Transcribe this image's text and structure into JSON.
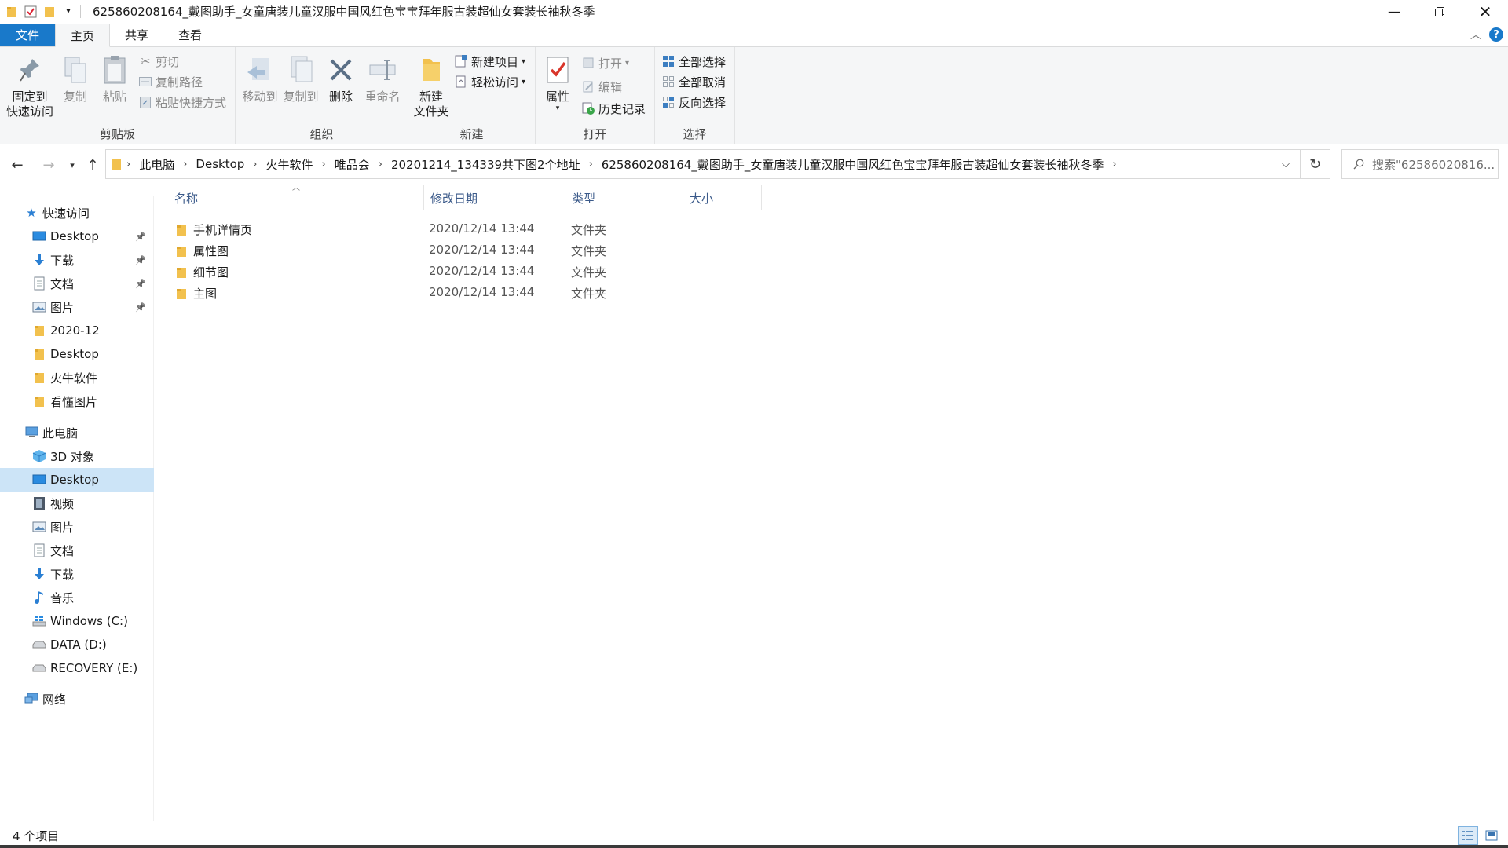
{
  "window": {
    "title": "625860208164_戴图助手_女童唐装儿童汉服中国风红色宝宝拜年服古装超仙女套装长袖秋冬季"
  },
  "ribbon_tabs": [
    "文件",
    "主页",
    "共享",
    "查看"
  ],
  "ribbon": {
    "clipboard": {
      "pin_label_1": "固定到",
      "pin_label_2": "快速访问",
      "copy": "复制",
      "paste": "粘贴",
      "cut": "剪切",
      "copy_path": "复制路径",
      "paste_shortcut": "粘贴快捷方式",
      "group": "剪贴板"
    },
    "organize": {
      "move_to": "移动到",
      "copy_to": "复制到",
      "delete": "删除",
      "rename": "重命名",
      "group": "组织"
    },
    "new": {
      "new_folder_1": "新建",
      "new_folder_2": "文件夹",
      "new_item": "新建项目",
      "easy_access": "轻松访问",
      "group": "新建"
    },
    "open": {
      "properties": "属性",
      "open": "打开",
      "edit": "编辑",
      "history": "历史记录",
      "group": "打开"
    },
    "select": {
      "select_all": "全部选择",
      "select_none": "全部取消",
      "invert": "反向选择",
      "group": "选择"
    }
  },
  "address": {
    "crumbs": [
      "此电脑",
      "Desktop",
      "火牛软件",
      "唯品会",
      "20201214_134339共下图2个地址",
      "625860208164_戴图助手_女童唐装儿童汉服中国风红色宝宝拜年服古装超仙女套装长袖秋冬季"
    ],
    "search_placeholder": "搜索\"62586020816..."
  },
  "nav": {
    "quick_access": "快速访问",
    "quick_items": [
      {
        "label": "Desktop",
        "icon": "desktop-icon",
        "pinned": true
      },
      {
        "label": "下载",
        "icon": "download-icon",
        "pinned": true
      },
      {
        "label": "文档",
        "icon": "document-icon",
        "pinned": true
      },
      {
        "label": "图片",
        "icon": "pictures-icon",
        "pinned": true
      },
      {
        "label": "2020-12",
        "icon": "folder-icon",
        "pinned": false
      },
      {
        "label": "Desktop",
        "icon": "folder-icon",
        "pinned": false
      },
      {
        "label": "火牛软件",
        "icon": "folder-icon",
        "pinned": false
      },
      {
        "label": "看懂图片",
        "icon": "folder-icon",
        "pinned": false
      }
    ],
    "this_pc": "此电脑",
    "pc_items": [
      {
        "label": "3D 对象",
        "icon": "3d-objects-icon"
      },
      {
        "label": "Desktop",
        "icon": "desktop-icon",
        "selected": true
      },
      {
        "label": "视频",
        "icon": "video-icon"
      },
      {
        "label": "图片",
        "icon": "pictures-icon"
      },
      {
        "label": "文档",
        "icon": "document-icon"
      },
      {
        "label": "下载",
        "icon": "download-icon"
      },
      {
        "label": "音乐",
        "icon": "music-icon"
      },
      {
        "label": "Windows (C:)",
        "icon": "windows-drive-icon"
      },
      {
        "label": "DATA (D:)",
        "icon": "drive-icon"
      },
      {
        "label": "RECOVERY (E:)",
        "icon": "drive-icon"
      }
    ],
    "network": "网络"
  },
  "columns": {
    "name": "名称",
    "date": "修改日期",
    "type": "类型",
    "size": "大小"
  },
  "files": [
    {
      "name": "手机详情页",
      "date": "2020/12/14 13:44",
      "type": "文件夹"
    },
    {
      "name": "属性图",
      "date": "2020/12/14 13:44",
      "type": "文件夹"
    },
    {
      "name": "细节图",
      "date": "2020/12/14 13:44",
      "type": "文件夹"
    },
    {
      "name": "主图",
      "date": "2020/12/14 13:44",
      "type": "文件夹"
    }
  ],
  "status": {
    "count": "4 个项目"
  },
  "colors": {
    "accent": "#1979ca",
    "folder": "#f2c14e",
    "selection": "#cce4f7"
  }
}
